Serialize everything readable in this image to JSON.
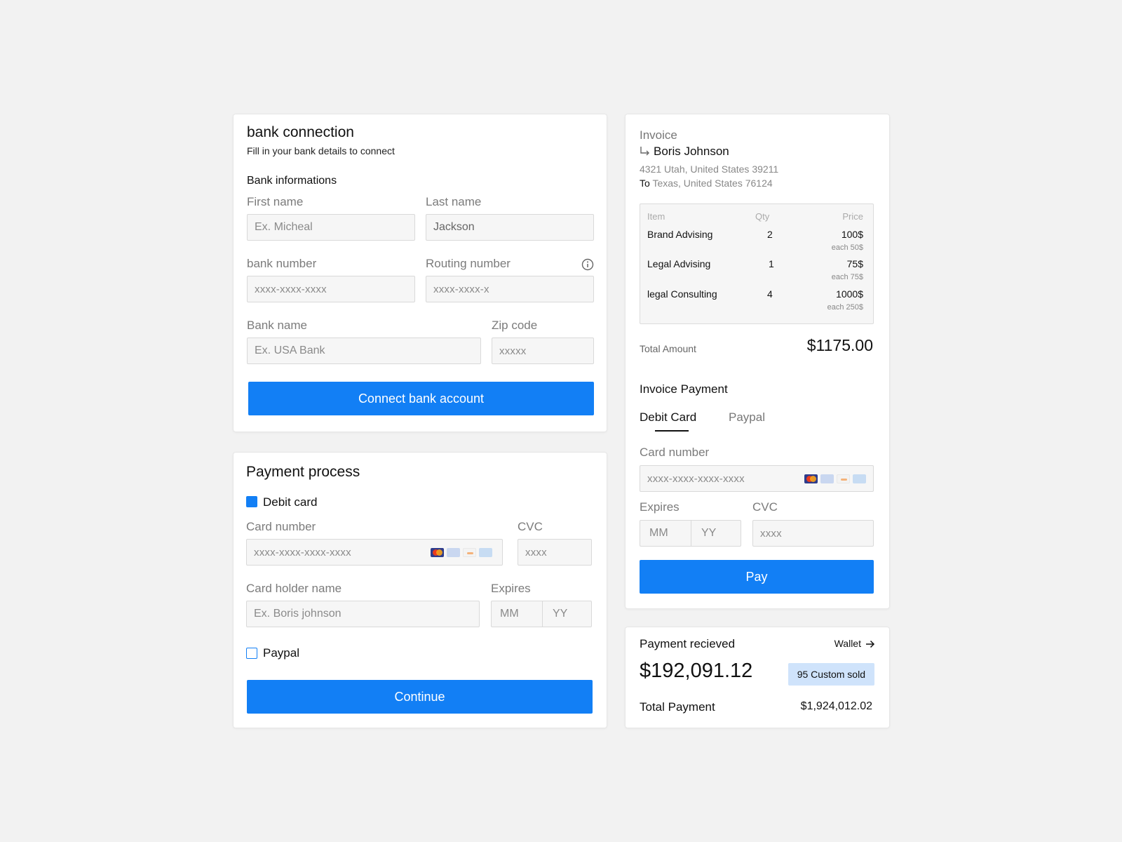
{
  "colors": {
    "accent": "#127ff5",
    "background": "#f2f2f2",
    "badge": "#cfe3fb"
  },
  "bank": {
    "title": "bank connection",
    "subtitle": "Fill in your bank details to connect",
    "section": "Bank informations",
    "first_name_label": "First name",
    "first_name_placeholder": "Ex. Micheal",
    "last_name_label": "Last name",
    "last_name_value": "Jackson",
    "bank_number_label": "bank number",
    "bank_number_placeholder": "xxxx-xxxx-xxxx",
    "routing_label": "Routing number",
    "routing_placeholder": "xxxx-xxxx-x",
    "bank_name_label": "Bank name",
    "bank_name_placeholder": "Ex. USA Bank",
    "zip_label": "Zip code",
    "zip_placeholder": "xxxxx",
    "button": "Connect bank account"
  },
  "payment": {
    "title": "Payment process",
    "debit_label": "Debit card",
    "card_number_label": "Card number",
    "card_number_placeholder": "xxxx-xxxx-xxxx-xxxx",
    "cvc_label": "CVC",
    "cvc_placeholder": "xxxx",
    "holder_label": "Card holder name",
    "holder_placeholder": "Ex. Boris johnson",
    "expires_label": "Expires",
    "mm": "MM",
    "yy": "YY",
    "paypal_label": "Paypal",
    "button": "Continue"
  },
  "invoice": {
    "title": "Invoice",
    "name": "Boris Johnson",
    "from_address": "4321 Utah, United States 39211",
    "to_label": "To",
    "to_address": "Texas, United States 76124",
    "headers": {
      "item": "Item",
      "qty": "Qty",
      "price": "Price"
    },
    "rows": [
      {
        "item": "Brand Advising",
        "qty": "2",
        "price": "100$",
        "each": "each 50$"
      },
      {
        "item": "Legal Advising",
        "qty": "1",
        "price": "75$",
        "each": "each 75$"
      },
      {
        "item": "legal Consulting",
        "qty": "4",
        "price": "1000$",
        "each": "each 250$"
      }
    ],
    "total_label": "Total Amount",
    "total_value": "$1175.00",
    "payment_title": "Invoice Payment",
    "tabs": [
      "Debit Card",
      "Paypal"
    ],
    "card_number_label": "Card number",
    "card_number_placeholder": "xxxx-xxxx-xxxx-xxxx",
    "expires_label": "Expires",
    "mm": "MM",
    "yy": "YY",
    "cvc_label": "CVC",
    "cvc_placeholder": "xxxx",
    "button": "Pay"
  },
  "received": {
    "title": "Payment recieved",
    "wallet": "Wallet",
    "amount": "$192,091.12",
    "badge": "95 Custom sold",
    "total_label": "Total Payment",
    "total_value": "$1,924,012.02"
  },
  "icons": {
    "info": "info-icon",
    "return_arrow": "return-arrow-icon",
    "right_arrow": "arrow-right-icon"
  }
}
